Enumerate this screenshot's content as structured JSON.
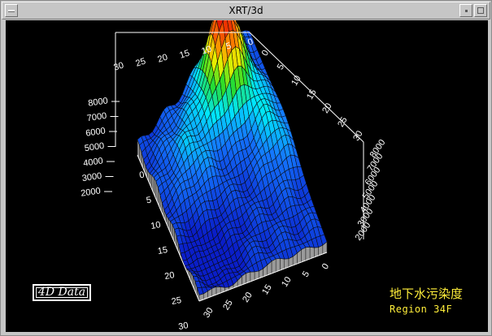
{
  "window": {
    "title": "XRT/3d"
  },
  "colors": {
    "accent_label": "#ffee3a",
    "background": "#000000",
    "axis": "#ffffff",
    "floor": "#8f8f8f"
  },
  "icons": {
    "menu": "window-menu-icon",
    "minimize": "minimize-icon",
    "maximize": "maximize-icon"
  },
  "plot": {
    "badge": "4D Data",
    "label_cn": "地下水污染度",
    "region": "Region 34F",
    "z_ticks": [
      "8000",
      "7000",
      "6000",
      "5000",
      "4000",
      "3000",
      "2000"
    ],
    "right_z_ticks": [
      "8000",
      "7000",
      "6000",
      "5000",
      "4000",
      "3000",
      "2000"
    ],
    "top_ticks": [
      "30",
      "25",
      "20",
      "15",
      "10",
      "5",
      "0"
    ],
    "top_right_ticks": [
      "0",
      "5",
      "10",
      "15",
      "20",
      "25",
      "30"
    ],
    "bottom_ticks": [
      "30",
      "25",
      "20",
      "15",
      "10",
      "5",
      "0"
    ],
    "left_ticks": [
      "0",
      "5",
      "10",
      "15",
      "20",
      "25",
      "30"
    ]
  },
  "chart_data": {
    "type": "surface",
    "x_range": [
      0,
      30
    ],
    "y_range": [
      0,
      30
    ],
    "z_range": [
      2000,
      8000
    ],
    "grid": true,
    "legend": "none"
  }
}
